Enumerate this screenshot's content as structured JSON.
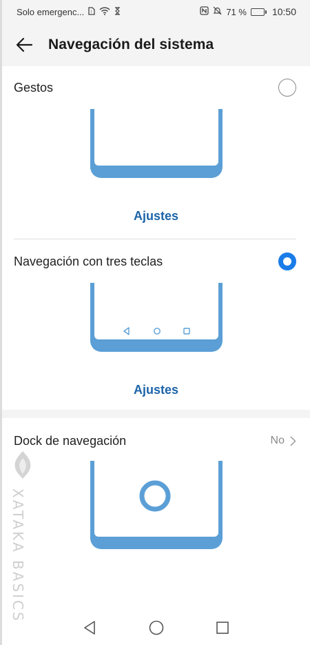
{
  "status_bar": {
    "carrier": "Solo emergenc...",
    "battery_percent": "71 %",
    "battery_level": 0.71,
    "time": "10:50",
    "icons": [
      "sim-icon",
      "wifi-icon",
      "hourglass-icon",
      "nfc-icon",
      "mute-icon",
      "battery-icon"
    ]
  },
  "header": {
    "title": "Navegación del sistema",
    "back_icon": "arrow-left-icon"
  },
  "options": {
    "gestures": {
      "label": "Gestos",
      "selected": false,
      "settings_label": "Ajustes"
    },
    "three_keys": {
      "label": "Navegación con tres teclas",
      "selected": true,
      "settings_label": "Ajustes"
    },
    "dock": {
      "label": "Dock de navegación",
      "value": "No"
    }
  },
  "watermark": {
    "text": "XATAKA BASICS"
  },
  "nav_bar": {
    "icons": [
      "back-triangle-icon",
      "home-circle-icon",
      "recents-square-icon"
    ]
  },
  "colors": {
    "accent": "#1a7ce8",
    "link": "#1c64a8",
    "illustration": "#5b9fd6",
    "illustration_dark": "#4a8cc4"
  }
}
